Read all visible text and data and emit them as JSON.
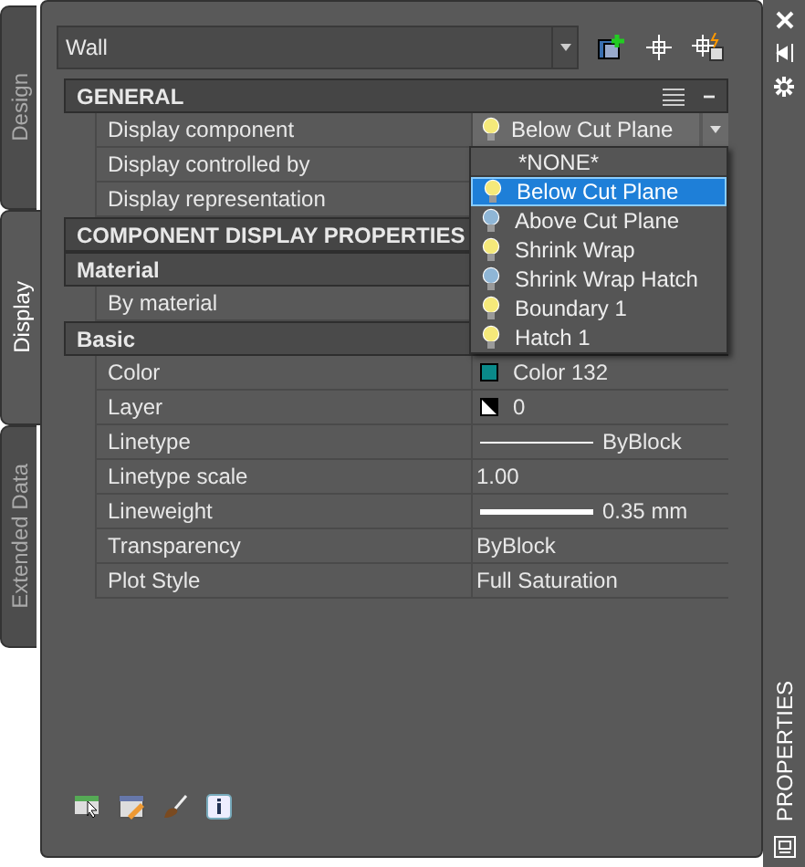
{
  "side_tabs": [
    {
      "label": "Design",
      "selected": false
    },
    {
      "label": "Display",
      "selected": true
    },
    {
      "label": "Extended Data",
      "selected": false
    }
  ],
  "object_selector": {
    "value": "Wall"
  },
  "grid": [
    {
      "kind": "category",
      "label": "GENERAL",
      "collapse": "−"
    },
    {
      "kind": "dropdown_row",
      "name": "Display component",
      "value": "Below Cut Plane"
    },
    {
      "kind": "row",
      "name": "Display controlled by"
    },
    {
      "kind": "row",
      "name": "Display representation"
    },
    {
      "kind": "category",
      "label": "COMPONENT DISPLAY PROPERTIES"
    },
    {
      "kind": "subcategory",
      "label": "Material"
    },
    {
      "kind": "row",
      "name": "By material"
    },
    {
      "kind": "subcategory",
      "label": "Basic"
    },
    {
      "kind": "swatch_row",
      "name": "Color",
      "value": "Color 132",
      "color": "#0a8a8a"
    },
    {
      "kind": "layer_row",
      "name": "Layer",
      "value": "0"
    },
    {
      "kind": "line_row",
      "name": "Linetype",
      "value": "ByBlock"
    },
    {
      "kind": "text_row",
      "name": "Linetype scale",
      "value": "1.00"
    },
    {
      "kind": "thick_line_row",
      "name": "Lineweight",
      "value": "0.35 mm"
    },
    {
      "kind": "text_row",
      "name": "Transparency",
      "value": "ByBlock"
    },
    {
      "kind": "text_row",
      "name": "Plot Style",
      "value": "Full Saturation"
    }
  ],
  "dropdown": {
    "items": [
      {
        "label": "*NONE*",
        "selected": false,
        "kind": "plain"
      },
      {
        "label": "Below Cut Plane",
        "selected": true,
        "kind": "lit"
      },
      {
        "label": "Above Cut Plane",
        "selected": false,
        "kind": "unlit"
      },
      {
        "label": "Shrink Wrap",
        "selected": false,
        "kind": "lit"
      },
      {
        "label": "Shrink Wrap Hatch",
        "selected": false,
        "kind": "unlit"
      },
      {
        "label": "Boundary 1",
        "selected": false,
        "kind": "lit"
      },
      {
        "label": "Hatch 1",
        "selected": false,
        "kind": "lit"
      }
    ]
  },
  "palette_title": "PROPERTIES"
}
